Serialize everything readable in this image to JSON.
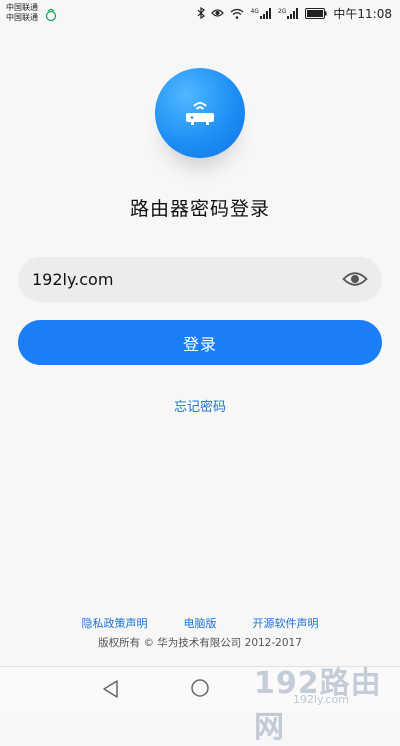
{
  "status_bar": {
    "carrier_1": "中国联通",
    "carrier_2": "中国联通",
    "network_1": "4G",
    "network_2": "2G",
    "time": "中午11:08"
  },
  "title": "路由器密码登录",
  "password_field": {
    "value": "192ly.com"
  },
  "login_button": "登录",
  "forgot_link": "忘记密码",
  "footer": {
    "links": [
      "隐私政策声明",
      "电脑版",
      "开源软件声明"
    ],
    "copyright": "版权所有 © 华为技术有限公司 2012-2017"
  },
  "watermark": {
    "main": "192路由网",
    "sub": "192ly.com"
  },
  "colors": {
    "accent": "#1a7ff7",
    "link": "#1a73d9",
    "background": "#f7f7f7"
  }
}
